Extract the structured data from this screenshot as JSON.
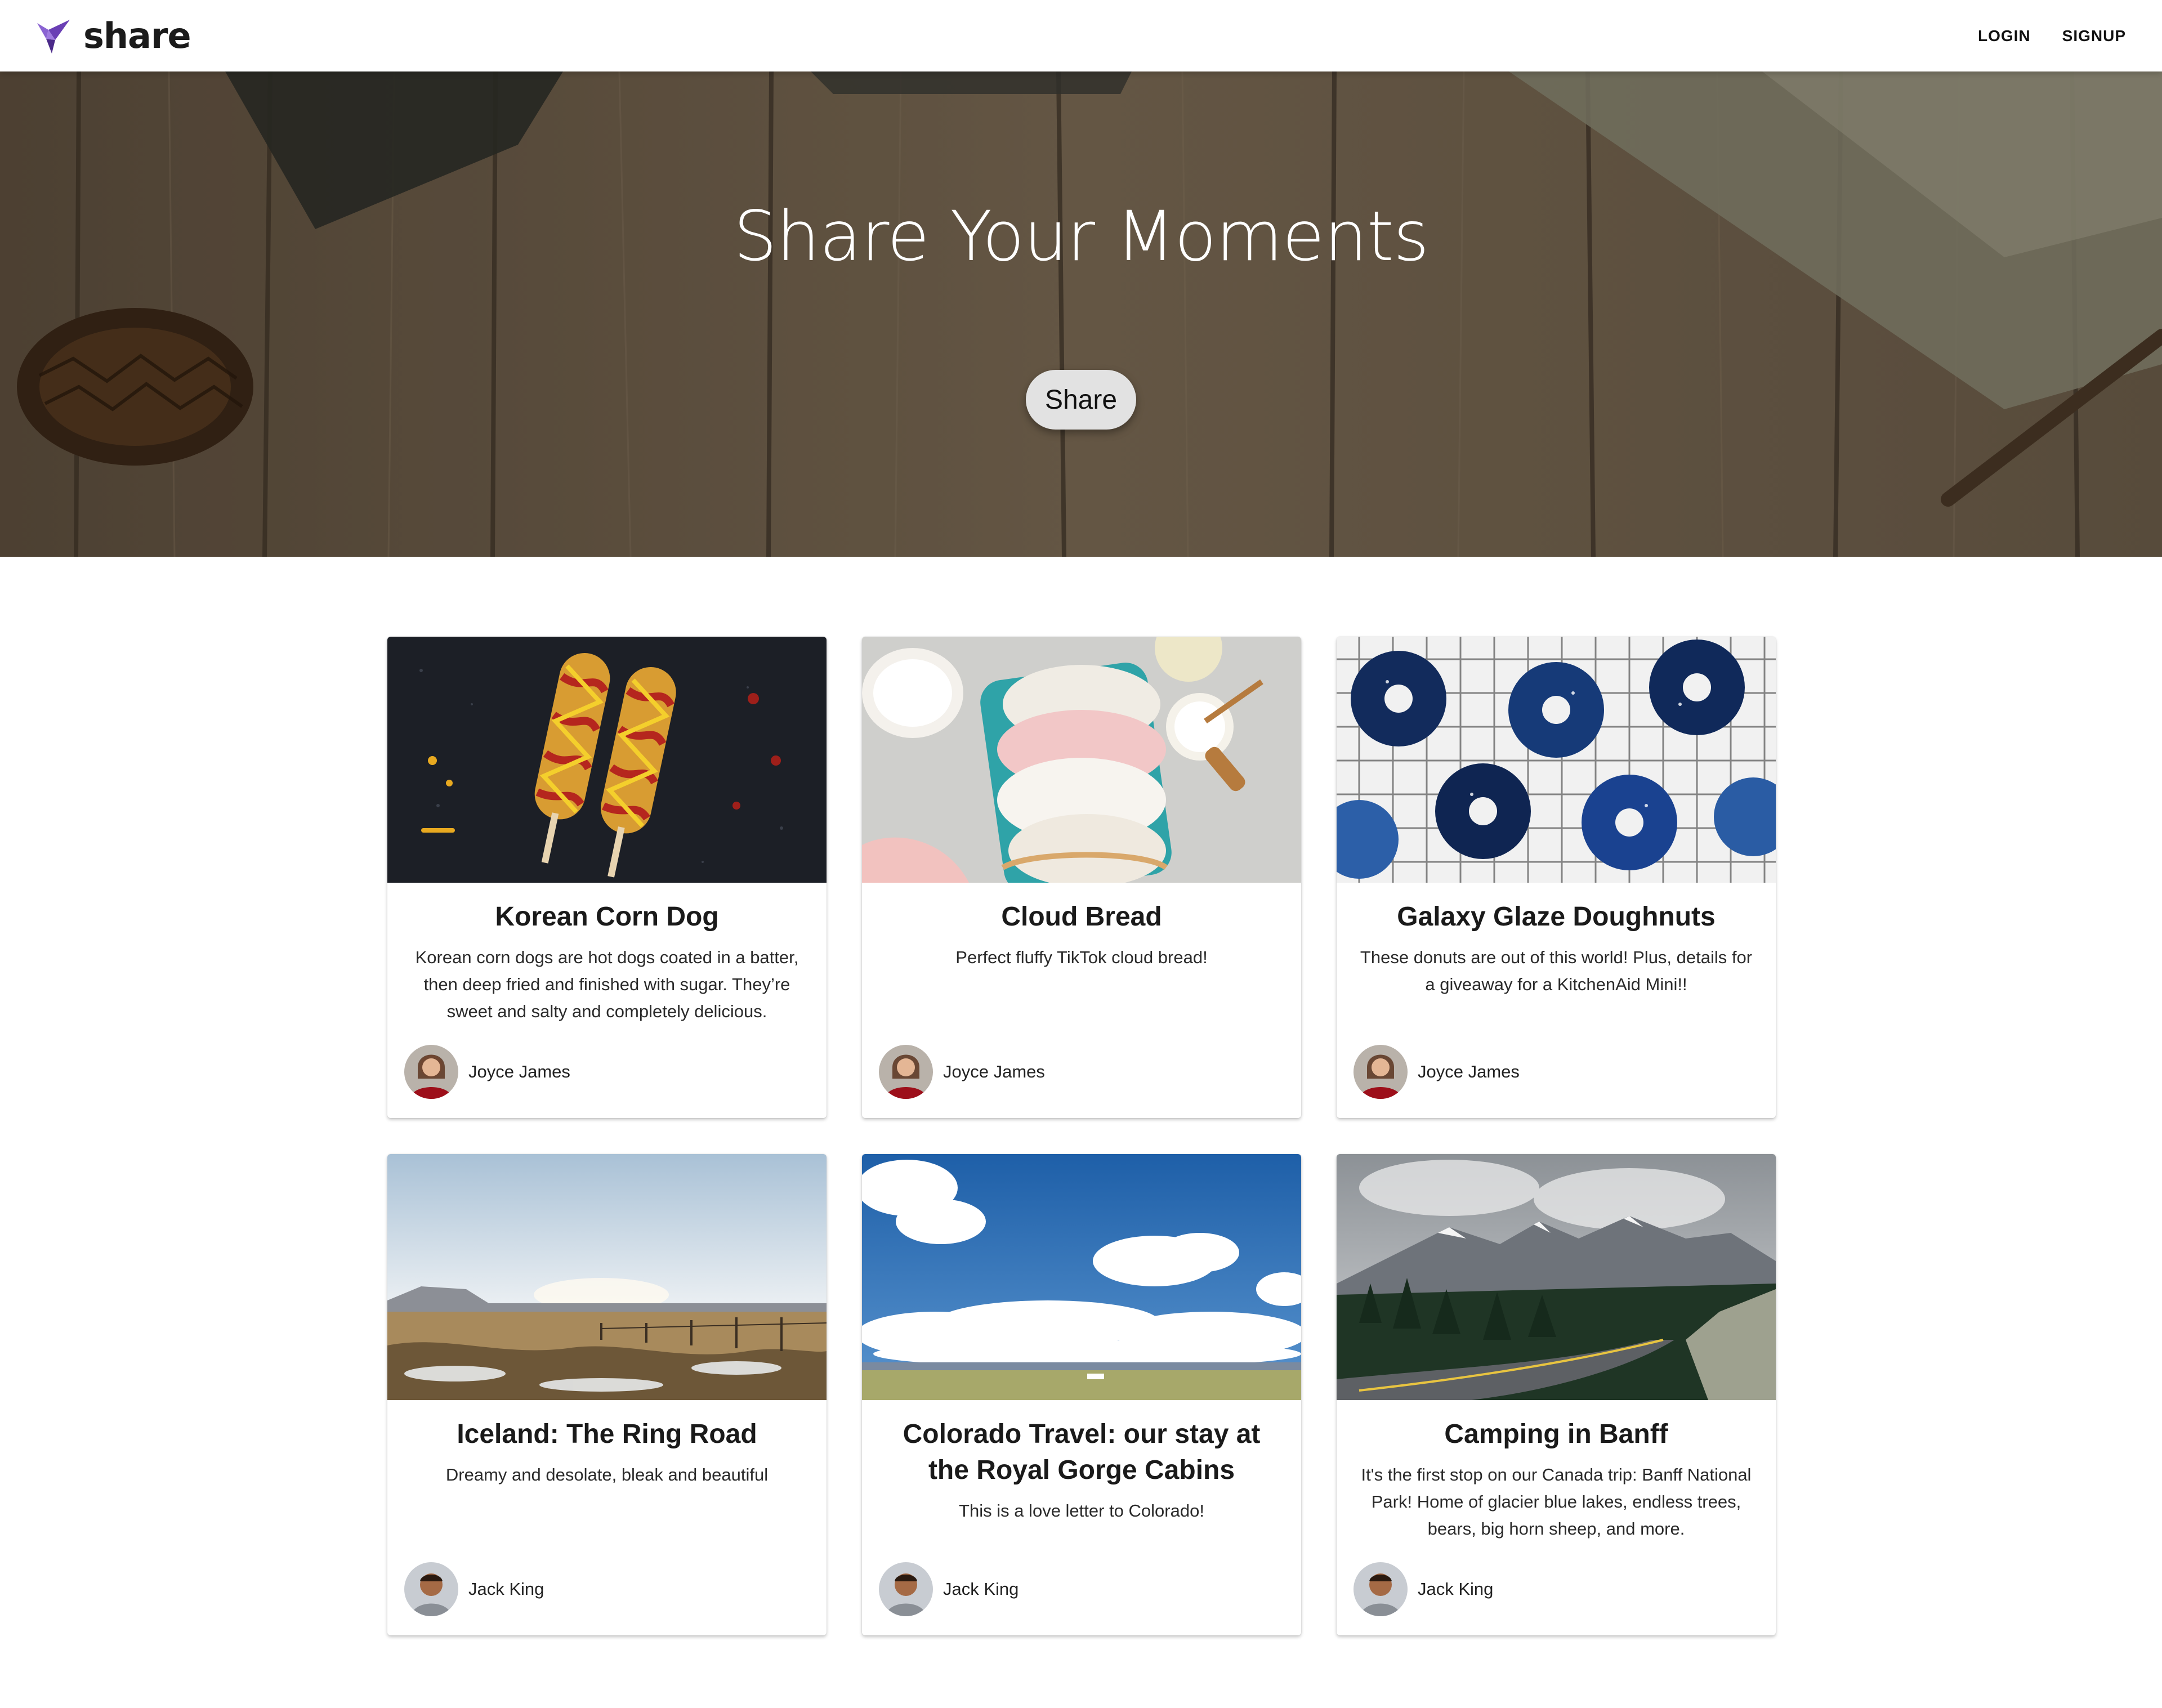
{
  "app": {
    "brand": "share",
    "nav": {
      "login": "LOGIN",
      "signup": "SIGNUP"
    }
  },
  "hero": {
    "title": "Share Your Moments",
    "button": "Share"
  },
  "posts": [
    {
      "title": "Korean Corn Dog",
      "text": "Korean corn dogs are hot dogs coated in a batter, then deep fried and finished with sugar. They’re sweet and salty and completely delicious.",
      "author": "Joyce James",
      "image": "korean-corn-dog-photo"
    },
    {
      "title": "Cloud Bread",
      "text": "Perfect fluffy TikTok cloud bread!",
      "author": "Joyce James",
      "image": "cloud-bread-photo"
    },
    {
      "title": "Galaxy Glaze Doughnuts",
      "text": "These donuts are out of this world! Plus, details for a giveaway for a KitchenAid Mini!!",
      "author": "Joyce James",
      "image": "galaxy-doughnuts-photo"
    },
    {
      "title": "Iceland: The Ring Road",
      "text": "Dreamy and desolate, bleak and beautiful",
      "author": "Jack King",
      "image": "iceland-landscape-photo"
    },
    {
      "title": "Colorado Travel: our stay at the Royal Gorge Cabins",
      "text": "This is a love letter to Colorado!",
      "author": "Jack King",
      "image": "colorado-sky-photo"
    },
    {
      "title": "Camping in Banff",
      "text": "It's the first stop on our Canada trip: Banff National Park! Home of glacier blue lakes, endless trees, bears, big horn sheep, and more.",
      "author": "Jack King",
      "image": "banff-road-photo"
    }
  ],
  "colors": {
    "brand_purple": "#6a3fb5",
    "hero_wood": "#6b5b48",
    "card_bg": "#ffffff"
  }
}
